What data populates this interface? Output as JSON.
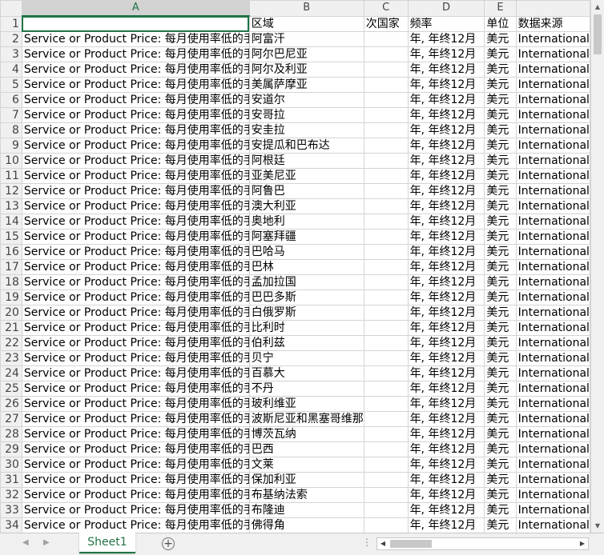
{
  "columns": [
    {
      "letter": "A",
      "selected": true
    },
    {
      "letter": "B",
      "selected": false
    },
    {
      "letter": "C",
      "selected": false
    },
    {
      "letter": "D",
      "selected": false
    },
    {
      "letter": "E",
      "selected": false
    },
    {
      "letter": "",
      "selected": false
    }
  ],
  "header_row": {
    "num": "1",
    "a": "",
    "b": "区域",
    "c": "次国家",
    "d": "频率",
    "e": "单位",
    "f": "数据来源"
  },
  "rows": [
    {
      "num": "2",
      "b": "阿富汗"
    },
    {
      "num": "3",
      "b": "阿尔巴尼亚"
    },
    {
      "num": "4",
      "b": "阿尔及利亚"
    },
    {
      "num": "5",
      "b": "美属萨摩亚"
    },
    {
      "num": "6",
      "b": "安道尔"
    },
    {
      "num": "7",
      "b": "安哥拉"
    },
    {
      "num": "8",
      "b": "安圭拉"
    },
    {
      "num": "9",
      "b": "安提瓜和巴布达"
    },
    {
      "num": "10",
      "b": "阿根廷"
    },
    {
      "num": "11",
      "b": "亚美尼亚"
    },
    {
      "num": "12",
      "b": "阿鲁巴"
    },
    {
      "num": "13",
      "b": "澳大利亚"
    },
    {
      "num": "14",
      "b": "奥地利"
    },
    {
      "num": "15",
      "b": "阿塞拜疆"
    },
    {
      "num": "16",
      "b": "巴哈马"
    },
    {
      "num": "17",
      "b": "巴林"
    },
    {
      "num": "18",
      "b": "孟加拉国"
    },
    {
      "num": "19",
      "b": "巴巴多斯"
    },
    {
      "num": "20",
      "b": "白俄罗斯"
    },
    {
      "num": "21",
      "b": "比利时"
    },
    {
      "num": "22",
      "b": "伯利兹"
    },
    {
      "num": "23",
      "b": "贝宁"
    },
    {
      "num": "24",
      "b": "百慕大"
    },
    {
      "num": "25",
      "b": "不丹"
    },
    {
      "num": "26",
      "b": "玻利维亚"
    },
    {
      "num": "27",
      "b": "波斯尼亚和黑塞哥维那"
    },
    {
      "num": "28",
      "b": "博茨瓦纳"
    },
    {
      "num": "29",
      "b": "巴西"
    },
    {
      "num": "30",
      "b": "文莱"
    },
    {
      "num": "31",
      "b": "保加利亚"
    },
    {
      "num": "32",
      "b": "布基纳法索"
    },
    {
      "num": "33",
      "b": "布隆迪"
    },
    {
      "num": "34",
      "b": "佛得角"
    }
  ],
  "row_defaults": {
    "a": "Service or Product Price:  每月使用率低的手机:  标准",
    "c": "",
    "d": "年, 年终12月",
    "e": "美元",
    "f": "International"
  },
  "sheet_tab": "Sheet1",
  "accent_color": "#217346",
  "icons": {
    "add_sheet": "plus-circle-icon",
    "scroll_up": "triangle-up-icon",
    "scroll_down": "triangle-down-icon",
    "scroll_left": "triangle-left-icon",
    "scroll_right": "triangle-right-icon"
  }
}
